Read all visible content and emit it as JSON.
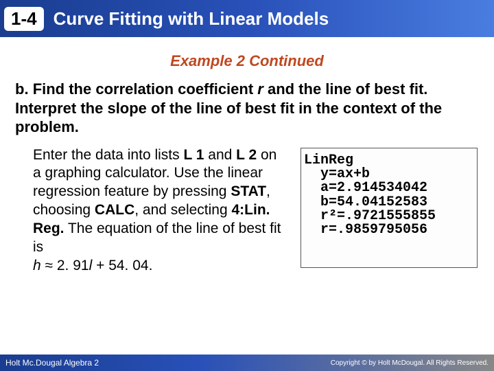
{
  "header": {
    "lesson_number": "1-4",
    "title": "Curve Fitting with Linear Models"
  },
  "example_title": "Example 2 Continued",
  "problem": {
    "label": "b.",
    "text_before_r": "Find the correlation coefficient ",
    "r_var": "r",
    "text_after_r": " and the line of best fit. Interpret the slope of the line of best fit in the context of the problem."
  },
  "instructions": {
    "p1a": "Enter the data into lists ",
    "L1": "L 1",
    "p1b": " and ",
    "L2": "L 2",
    "p1c": " on a graphing calculator. Use the linear regression feature by pressing ",
    "STAT": "STAT",
    "p1d": ", choosing ",
    "CALC": "CALC",
    "p1e": ", and selecting ",
    "LINREG": "4:Lin. Reg.",
    "p1f": " The equation of the line of best fit is",
    "eq_h": "h",
    "eq_approx": " ≈ 2. 91",
    "eq_l": "l",
    "eq_rest": " + 54. 04."
  },
  "calculator": {
    "line1": "LinReg",
    "line2": "y=ax+b",
    "line3": "a=2.914534042",
    "line4": "b=54.04152583",
    "line5": "r²=.9721555855",
    "line6": "r=.9859795056"
  },
  "footer": {
    "left": "Holt Mc.Dougal Algebra 2",
    "right": "Copyright © by Holt McDougal. All Rights Reserved."
  }
}
